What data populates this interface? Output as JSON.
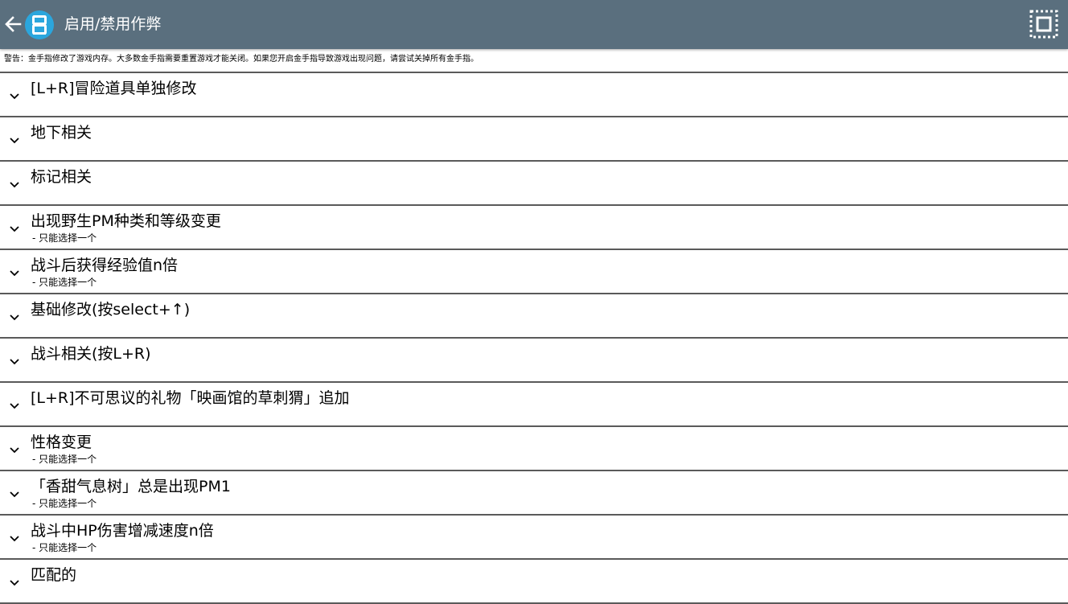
{
  "header": {
    "title": "启用/禁用作弊",
    "icons": {
      "back": "arrow-left-icon",
      "logo": "app-logo-icon",
      "select_all": "select-all-icon"
    },
    "colors": {
      "bar": "#5a6f7e",
      "logo_circle": "#2ba6dd",
      "divider": "#5a5a5a"
    }
  },
  "warning": "警告：金手指修改了游戏内存。大多数金手指需要重置游戏才能关闭。如果您开启金手指导致游戏出现问题，请尝试关掉所有金手指。",
  "cheat_groups": [
    {
      "title": "[L+R]冒险道具单独修改",
      "subtitle": ""
    },
    {
      "title": "地下相关",
      "subtitle": ""
    },
    {
      "title": "标记相关",
      "subtitle": ""
    },
    {
      "title": "出现野生PM种类和等级变更",
      "subtitle": "- 只能选择一个"
    },
    {
      "title": "战斗后获得经验值n倍",
      "subtitle": "- 只能选择一个"
    },
    {
      "title": "基础修改(按select+↑)",
      "subtitle": ""
    },
    {
      "title": "战斗相关(按L+R)",
      "subtitle": ""
    },
    {
      "title": "[L+R]不可思议的礼物「映画馆的草刺猬」追加",
      "subtitle": ""
    },
    {
      "title": "性格变更",
      "subtitle": "- 只能选择一个"
    },
    {
      "title": "「香甜气息树」总是出现PM1",
      "subtitle": "- 只能选择一个"
    },
    {
      "title": "战斗中HP伤害增减速度n倍",
      "subtitle": "- 只能选择一个"
    },
    {
      "title": "匹配的",
      "subtitle": ""
    }
  ]
}
